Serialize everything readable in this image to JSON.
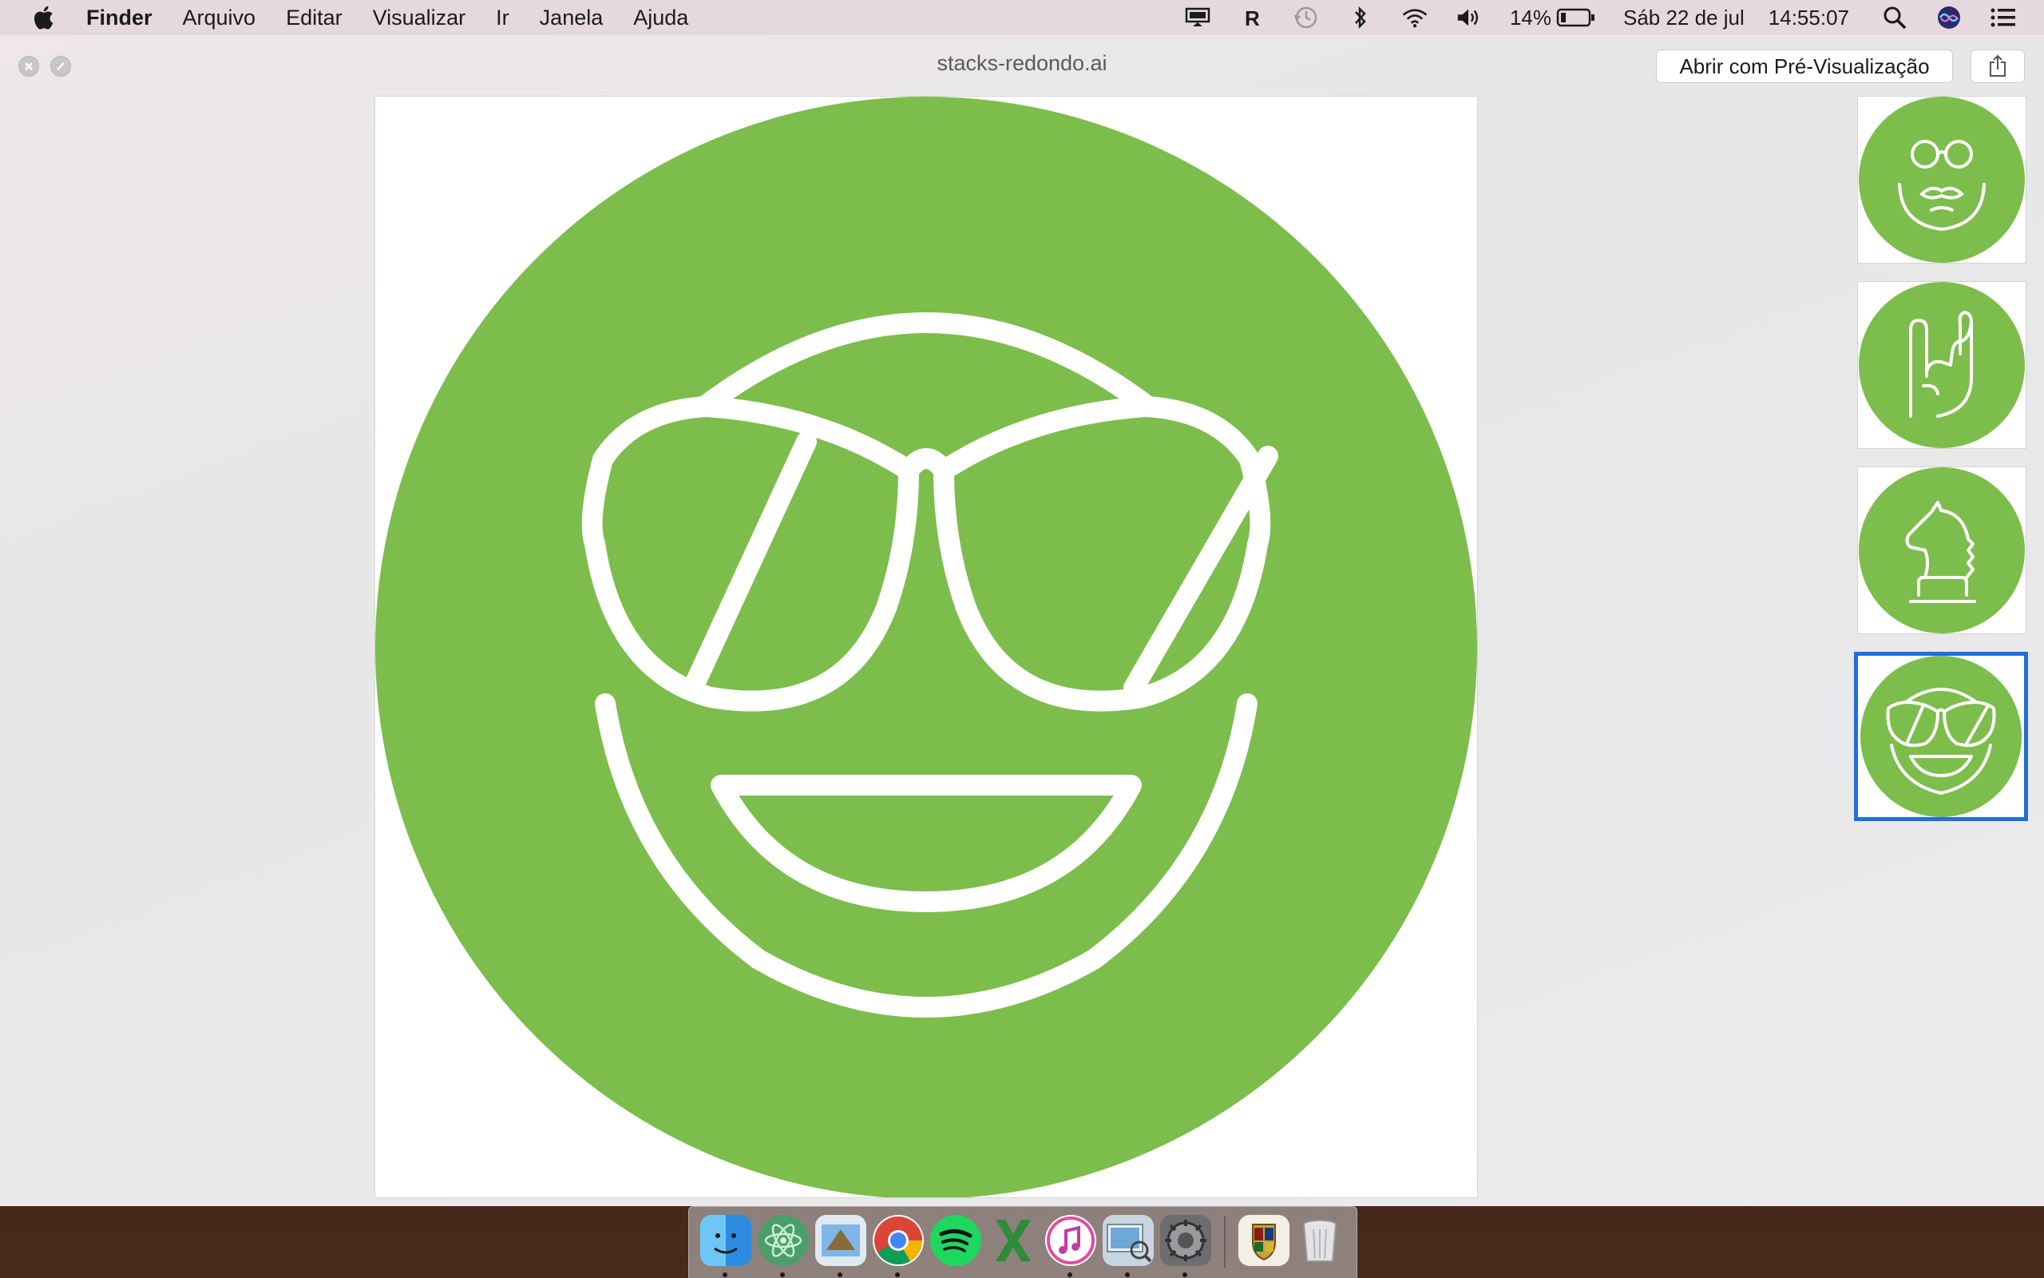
{
  "menubar": {
    "app_name": "Finder",
    "items": [
      "Arquivo",
      "Editar",
      "Visualizar",
      "Ir",
      "Janela",
      "Ajuda"
    ],
    "status": {
      "battery_percent": "14%",
      "date": "Sáb 22 de jul",
      "time": "14:55:07",
      "icons": [
        "display-icon",
        "r-icon",
        "time-machine-icon",
        "bluetooth-icon",
        "wifi-icon",
        "volume-icon",
        "battery-icon",
        "spotlight-icon",
        "siri-icon",
        "notification-center-icon"
      ]
    }
  },
  "window": {
    "title": "stacks-redondo.ai",
    "open_button_label": "Abrir com Pré-Visualização",
    "share_icon": "share-icon"
  },
  "preview": {
    "main_icon": "sunglasses-smiley-icon",
    "accent_color": "#7cbd4c",
    "selection_color": "#1f6fd8"
  },
  "thumbnails": [
    {
      "icon": "mustache-glasses-face-icon",
      "selected": false
    },
    {
      "icon": "rock-hand-icon",
      "selected": false
    },
    {
      "icon": "chess-knight-icon",
      "selected": false
    },
    {
      "icon": "sunglasses-smiley-icon",
      "selected": true
    }
  ],
  "dock": {
    "apps": [
      "Finder",
      "Atom",
      "Mail",
      "Chrome",
      "Spotify",
      "Excel",
      "iTunes",
      "Preview",
      "System Preferences",
      "Hogwarts",
      "Trash"
    ]
  }
}
